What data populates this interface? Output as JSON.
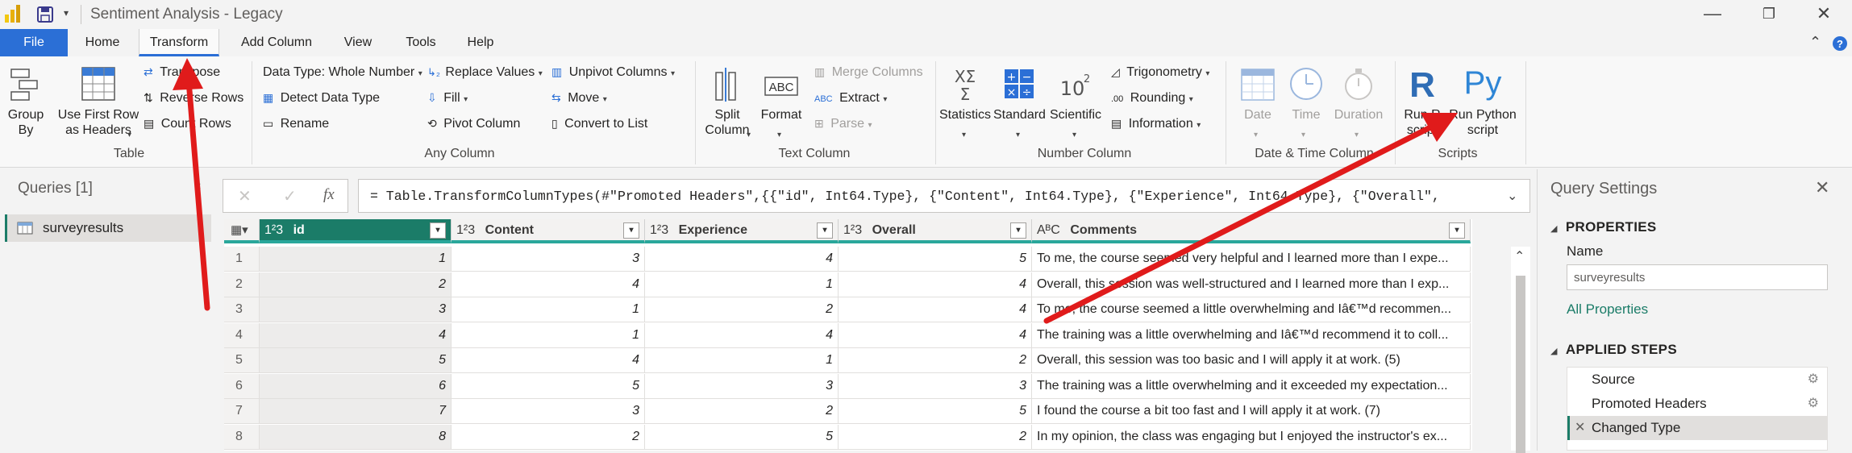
{
  "window": {
    "title": "Sentiment Analysis - Legacy",
    "controls": {
      "minimize": "—",
      "maximize": "❐",
      "close": "✕"
    }
  },
  "menu": {
    "tabs": [
      {
        "label": "File",
        "active": false
      },
      {
        "label": "Home",
        "active": false
      },
      {
        "label": "Transform",
        "active": true
      },
      {
        "label": "Add Column",
        "active": false
      },
      {
        "label": "View",
        "active": false
      },
      {
        "label": "Tools",
        "active": false
      },
      {
        "label": "Help",
        "active": false
      }
    ]
  },
  "ribbon": {
    "table_group": {
      "label": "Table",
      "group_by": "Group\nBy",
      "use_first_row": "Use First Row\nas Headers",
      "transpose": "Transpose",
      "reverse_rows": "Reverse Rows",
      "count_rows": "Count Rows"
    },
    "any_column_group": {
      "label": "Any Column",
      "data_type": "Data Type: Whole Number",
      "detect_data_type": "Detect Data Type",
      "rename": "Rename",
      "replace_values": "Replace Values",
      "fill": "Fill",
      "pivot_column": "Pivot Column",
      "unpivot_columns": "Unpivot Columns",
      "move": "Move",
      "convert_to_list": "Convert to List"
    },
    "text_column_group": {
      "label": "Text Column",
      "split_column": "Split\nColumn",
      "format": "Format",
      "merge_columns": "Merge Columns",
      "extract": "Extract",
      "parse": "Parse"
    },
    "number_column_group": {
      "label": "Number Column",
      "statistics": "Statistics",
      "standard": "Standard",
      "scientific": "Scientific",
      "trigonometry": "Trigonometry",
      "rounding": "Rounding",
      "information": "Information"
    },
    "datetime_group": {
      "label": "Date & Time Column",
      "date": "Date",
      "time": "Time",
      "duration": "Duration"
    },
    "scripts_group": {
      "label": "Scripts",
      "run_r": "Run R\nscript",
      "run_python": "Run Python\nscript"
    }
  },
  "formula": {
    "text": "= Table.TransformColumnTypes(#\"Promoted Headers\",{{\"id\", Int64.Type}, {\"Content\", Int64.Type}, {\"Experience\", Int64.Type}, {\"Overall\","
  },
  "queries": {
    "header": "Queries [1]",
    "items": [
      "surveyresults"
    ]
  },
  "grid": {
    "columns": [
      {
        "type_icon": "1²3",
        "name": "id"
      },
      {
        "type_icon": "1²3",
        "name": "Content"
      },
      {
        "type_icon": "1²3",
        "name": "Experience"
      },
      {
        "type_icon": "1²3",
        "name": "Overall"
      },
      {
        "type_icon": "AᴮC",
        "name": "Comments"
      }
    ],
    "rows": [
      {
        "n": "1",
        "id": "1",
        "content": "3",
        "experience": "4",
        "overall": "5",
        "comments": "To me, the course seemed very helpful and I learned more than I expe..."
      },
      {
        "n": "2",
        "id": "2",
        "content": "4",
        "experience": "1",
        "overall": "4",
        "comments": "Overall, this session was well-structured and I learned more than I exp..."
      },
      {
        "n": "3",
        "id": "3",
        "content": "1",
        "experience": "2",
        "overall": "4",
        "comments": "To me, the course seemed a little overwhelming and Iâ€™d recommen..."
      },
      {
        "n": "4",
        "id": "4",
        "content": "1",
        "experience": "4",
        "overall": "4",
        "comments": "The training was a little overwhelming and Iâ€™d recommend it to coll..."
      },
      {
        "n": "5",
        "id": "5",
        "content": "4",
        "experience": "1",
        "overall": "2",
        "comments": "Overall, this session was too basic and I will apply it at work. (5)"
      },
      {
        "n": "6",
        "id": "6",
        "content": "5",
        "experience": "3",
        "overall": "3",
        "comments": "The training was a little overwhelming and it exceeded my expectation..."
      },
      {
        "n": "7",
        "id": "7",
        "content": "3",
        "experience": "2",
        "overall": "5",
        "comments": "I found the course a bit too fast and I will apply it at work. (7)"
      },
      {
        "n": "8",
        "id": "8",
        "content": "2",
        "experience": "5",
        "overall": "2",
        "comments": "In my opinion, the class was engaging but I enjoyed the instructor's ex..."
      }
    ]
  },
  "settings": {
    "title": "Query Settings",
    "properties_header": "PROPERTIES",
    "name_label": "Name",
    "name_value": "surveyresults",
    "all_properties": "All Properties",
    "applied_steps_header": "APPLIED STEPS",
    "steps": [
      {
        "label": "Source",
        "has_gear": true
      },
      {
        "label": "Promoted Headers",
        "has_gear": true
      },
      {
        "label": "Changed Type",
        "has_gear": false
      }
    ]
  },
  "colors": {
    "accent": "#2b6fd6",
    "selected_header": "#1b7c68",
    "header_underline": "#2aa79b",
    "annotation_arrow": "#e01b1b",
    "python_blue": "#2f86d6"
  }
}
